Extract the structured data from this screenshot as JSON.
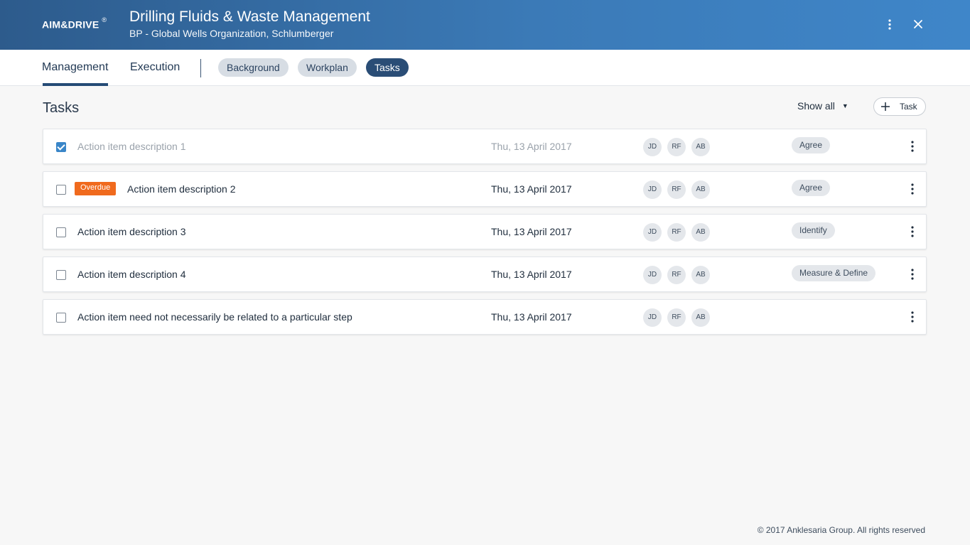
{
  "header": {
    "logo": "AIM&DRIVE",
    "logo_mark": "®",
    "title": "Drilling Fluids & Waste Management",
    "subtitle": "BP - Global Wells Organization, Schlumberger",
    "more_icon": "more-vertical-icon",
    "close_icon": "close-icon"
  },
  "nav": {
    "tabs": [
      {
        "label": "Management",
        "active": true
      },
      {
        "label": "Execution",
        "active": false
      }
    ],
    "pills": [
      {
        "label": "Background",
        "active": false
      },
      {
        "label": "Workplan",
        "active": false
      },
      {
        "label": "Tasks",
        "active": true
      }
    ]
  },
  "page": {
    "title": "Tasks",
    "filter_label": "Show all",
    "add_label": "Task"
  },
  "tasks": [
    {
      "checked": true,
      "overdue": false,
      "description": "Action item description 1",
      "date": "Thu, 13 April 2017",
      "assignees": [
        "JD",
        "RF",
        "AB"
      ],
      "step": "Agree"
    },
    {
      "checked": false,
      "overdue": true,
      "overdue_label": "Overdue",
      "description": "Action item description 2",
      "date": "Thu, 13 April 2017",
      "assignees": [
        "JD",
        "RF",
        "AB"
      ],
      "step": "Agree"
    },
    {
      "checked": false,
      "overdue": false,
      "description": "Action item description 3",
      "date": "Thu, 13 April 2017",
      "assignees": [
        "JD",
        "RF",
        "AB"
      ],
      "step": "Identify"
    },
    {
      "checked": false,
      "overdue": false,
      "description": "Action item description 4",
      "date": "Thu, 13 April 2017",
      "assignees": [
        "JD",
        "RF",
        "AB"
      ],
      "step": "Measure & Define"
    },
    {
      "checked": false,
      "overdue": false,
      "description": "Action item need not necessarily be related to a particular step",
      "date": "Thu, 13 April 2017",
      "assignees": [
        "JD",
        "RF",
        "AB"
      ],
      "step": ""
    }
  ],
  "footer": {
    "copyright": "© 2017 Anklesaria Group. All rights reserved"
  },
  "colors": {
    "brand": "#2d5b8c",
    "active_pill": "#2a4d76",
    "overdue": "#f06a1d",
    "checkbox": "#3a86c8"
  }
}
